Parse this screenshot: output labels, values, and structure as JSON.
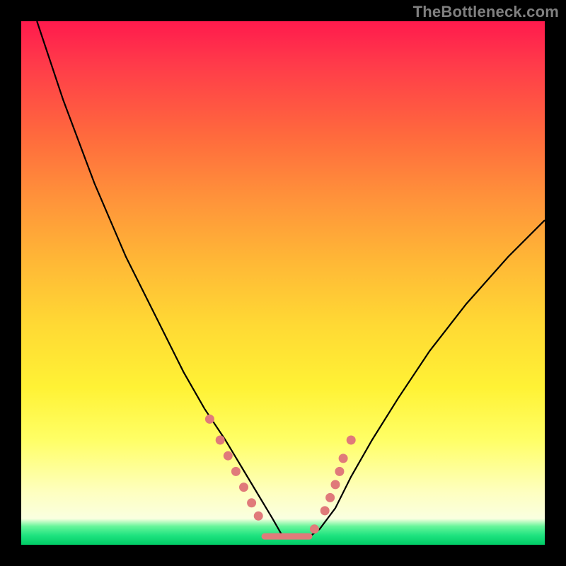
{
  "watermark": "TheBottleneck.com",
  "colors": {
    "bg_black": "#000000",
    "curve": "#000000",
    "dot": "#e07a7a",
    "grad_top": "#ff1a4d",
    "grad_bottom": "#00cc66"
  },
  "chart_data": {
    "type": "line",
    "title": "",
    "xlabel": "",
    "ylabel": "",
    "xlim": [
      0,
      100
    ],
    "ylim": [
      0,
      100
    ],
    "note": "No numeric axis labels visible; values below are estimated positions of the curve in percent of the plot area (0 = left/bottom, 100 = right/top).",
    "series": [
      {
        "name": "bottleneck-curve",
        "x": [
          3,
          8,
          14,
          20,
          26,
          31,
          35,
          39,
          42,
          45,
          48,
          50,
          53,
          55,
          57,
          60,
          63,
          67,
          72,
          78,
          85,
          93,
          100
        ],
        "y": [
          100,
          85,
          69,
          55,
          43,
          33,
          26,
          20,
          15,
          10,
          5,
          1.5,
          1.5,
          1.5,
          3,
          7,
          13,
          20,
          28,
          37,
          46,
          55,
          62
        ]
      }
    ],
    "markers": {
      "name": "highlighted-points",
      "comment": "Pink dots clustered on both curve flanks near the bottom, plus a flat pink segment at the valley floor.",
      "points_xy": [
        [
          36,
          24
        ],
        [
          38,
          20
        ],
        [
          39.5,
          17
        ],
        [
          41,
          14
        ],
        [
          42.5,
          11
        ],
        [
          44,
          8
        ],
        [
          45.3,
          5.5
        ],
        [
          56,
          3
        ],
        [
          58,
          6.5
        ],
        [
          59,
          9
        ],
        [
          60,
          11.5
        ],
        [
          60.8,
          14
        ],
        [
          61.5,
          16.5
        ],
        [
          63,
          20
        ]
      ],
      "flat_segment_x": [
        46.5,
        55
      ],
      "flat_segment_y": 1.6
    }
  }
}
